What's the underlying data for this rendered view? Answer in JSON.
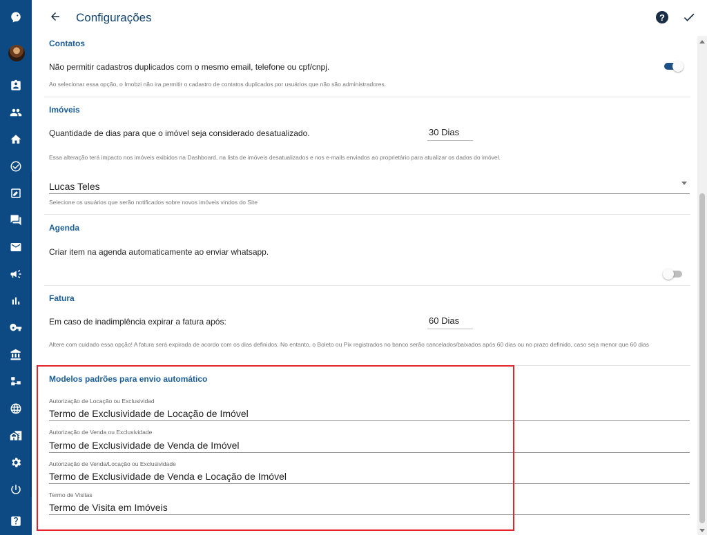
{
  "header": {
    "title": "Configurações",
    "help_icon": "question-circle-icon",
    "confirm_icon": "check-icon",
    "back_icon": "arrow-back-icon"
  },
  "sidebar": {
    "items": [
      {
        "icon": "logo-icon"
      },
      {
        "icon": "avatar"
      },
      {
        "icon": "contact-card-icon"
      },
      {
        "icon": "people-icon"
      },
      {
        "icon": "home-icon"
      },
      {
        "icon": "check-circle-icon"
      },
      {
        "icon": "edit-box-icon"
      },
      {
        "icon": "chat-icon"
      },
      {
        "icon": "mail-icon"
      },
      {
        "icon": "megaphone-icon"
      },
      {
        "icon": "bar-chart-icon"
      },
      {
        "icon": "key-icon"
      },
      {
        "icon": "bank-icon"
      },
      {
        "icon": "sitemap-icon"
      },
      {
        "icon": "globe-icon"
      },
      {
        "icon": "buildings-icon"
      },
      {
        "icon": "gear-icon"
      },
      {
        "icon": "power-icon"
      },
      {
        "icon": "help-box-icon"
      }
    ]
  },
  "contatos": {
    "title": "Contatos",
    "label": "Não permitir cadastros duplicados com o mesmo email, telefone ou cpf/cnpj.",
    "hint": "Ao selecionar essa opção, o Imobzi não ira permitir o cadastro de contatos duplicados por usuários que não são administradores.",
    "toggle_on": true
  },
  "imoveis": {
    "title": "Imóveis",
    "label": "Quantidade de dias para que o imóvel seja considerado desatualizado.",
    "days_value": "30 Dias",
    "hint": "Essa alteração terá impacto nos imóveis exibidos na Dashboard, na lista de imóveis desatualizados e nos e-mails enviados ao proprietário para atualizar os dados do imóvel.",
    "notify_user": "Lucas Teles",
    "notify_hint": "Selecione os usuários que serão notificados sobre novos imóveis vindos do Site"
  },
  "agenda": {
    "title": "Agenda",
    "label": "Criar item na agenda automaticamente ao enviar whatsapp.",
    "toggle_on": false
  },
  "fatura": {
    "title": "Fatura",
    "label": "Em caso de inadimplência expirar a fatura após:",
    "days_value": "60 Dias",
    "hint": "Altere com cuidado essa opção! A fatura será expirada de acordo com os dias definidos. No entanto, o Boleto ou Pix registrados no banco serão cancelados/baixados após 60 dias ou no prazo definido, caso seja menor que 60 dias"
  },
  "modelos": {
    "title": "Modelos padrões para envio automático",
    "fields": [
      {
        "label": "Autorização de Locação ou Exclusividad",
        "value": "Termo de Exclusividade de Locação de Imóvel"
      },
      {
        "label": "Autorização de Venda ou Exclusividade",
        "value": "Termo de Exclusividade de Venda de Imóvel"
      },
      {
        "label": "Autorização de Venda/Locação ou Exclusividade",
        "value": "Termo de Exclusividade de Venda e Locação de Imóvel"
      },
      {
        "label": "Termo de Visitas",
        "value": "Termo de Visita em Imóveis"
      }
    ]
  },
  "colors": {
    "sidebar": "#0d4a84",
    "accent": "#1b5d97",
    "highlight": "#e4232b"
  }
}
